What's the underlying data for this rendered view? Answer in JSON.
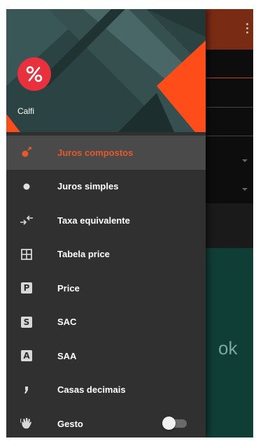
{
  "app": {
    "name": "Calfi",
    "logo_symbol": "%"
  },
  "menu": [
    {
      "id": "juros-compostos",
      "label": "Juros compostos",
      "icon": "dot-arrow-icon",
      "active": true
    },
    {
      "id": "juros-simples",
      "label": "Juros simples",
      "icon": "dot-icon",
      "active": false
    },
    {
      "id": "taxa-equivalente",
      "label": "Taxa equivalente",
      "icon": "swap-arrows-icon",
      "active": false
    },
    {
      "id": "tabela-price",
      "label": "Tabela price",
      "icon": "table-icon",
      "active": false
    },
    {
      "id": "price",
      "label": "Price",
      "icon": "letter-p-icon",
      "badge": "P",
      "active": false
    },
    {
      "id": "sac",
      "label": "SAC",
      "icon": "letter-s-icon",
      "badge": "S",
      "active": false
    },
    {
      "id": "saa",
      "label": "SAA",
      "icon": "letter-a-icon",
      "badge": "A",
      "active": false
    },
    {
      "id": "casas-decimais",
      "label": "Casas decimais",
      "icon": "comma-icon",
      "active": false
    },
    {
      "id": "gesto",
      "label": "Gesto",
      "icon": "hand-wave-icon",
      "active": false,
      "toggle": false
    }
  ],
  "background": {
    "button_label": "ok"
  },
  "colors": {
    "accent": "#e65a28",
    "drawer_bg": "#303030",
    "active_bg": "#4a4a4a",
    "logo_bg": "#e8313d",
    "toolbar": "#7a2b14",
    "teal": "#0f3e36"
  }
}
